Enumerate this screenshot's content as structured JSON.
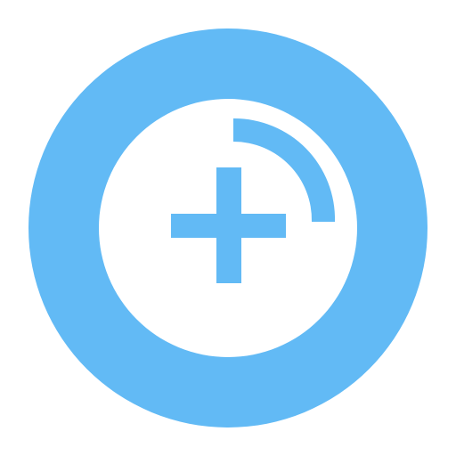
{
  "icon": {
    "name": "add-circle-icon",
    "parts": [
      "outer-ring",
      "inner-disc",
      "plus-sign",
      "highlight-arc"
    ]
  },
  "colors": {
    "background": "#ffffff",
    "ring": "#62baf5",
    "inner": "#ffffff",
    "glyph": "#62baf5"
  }
}
